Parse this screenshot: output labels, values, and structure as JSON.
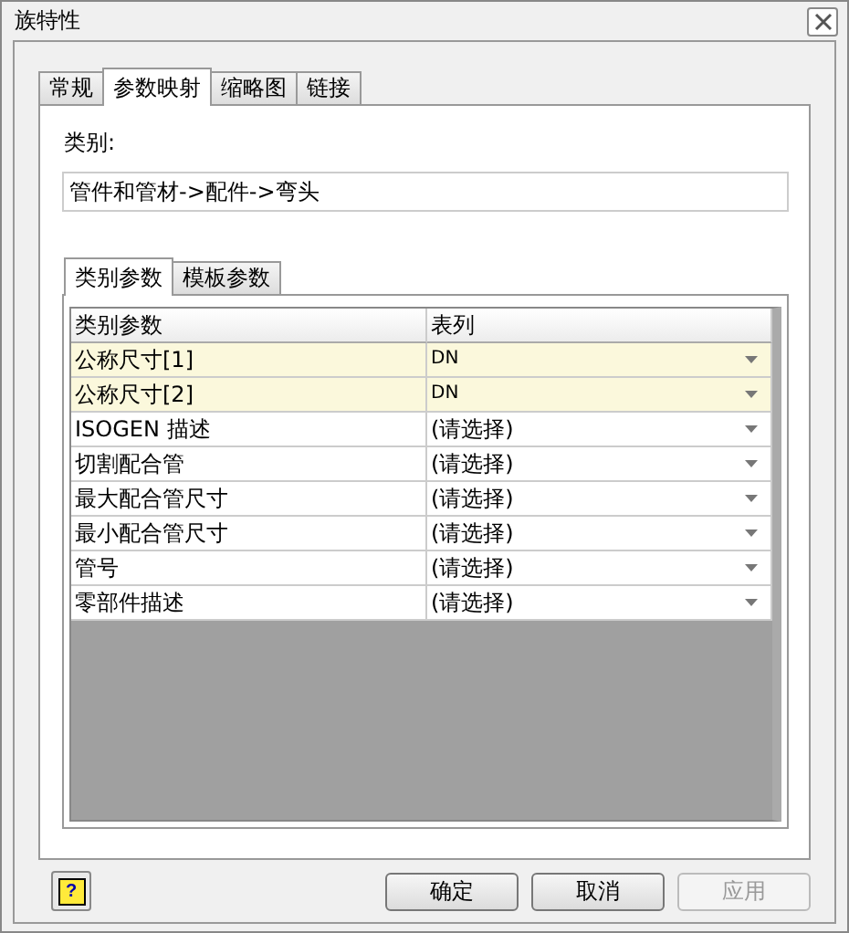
{
  "window": {
    "title": "族特性"
  },
  "tabs": [
    {
      "label": "常规",
      "selected": false
    },
    {
      "label": "参数映射",
      "selected": true
    },
    {
      "label": "缩略图",
      "selected": false
    },
    {
      "label": "链接",
      "selected": false
    }
  ],
  "category": {
    "label": "类别:",
    "value": "管件和管材->配件->弯头"
  },
  "sub_tabs": [
    {
      "label": "类别参数",
      "selected": true
    },
    {
      "label": "模板参数",
      "selected": false
    }
  ],
  "table": {
    "columns": [
      "类别参数",
      "表列"
    ],
    "rows": [
      {
        "param": "公称尺寸[1]",
        "column": "DN",
        "highlighted": true
      },
      {
        "param": "公称尺寸[2]",
        "column": "DN",
        "highlighted": true
      },
      {
        "param": "ISOGEN 描述",
        "column": "(请选择)",
        "highlighted": false
      },
      {
        "param": "切割配合管",
        "column": "(请选择)",
        "highlighted": false
      },
      {
        "param": "最大配合管尺寸",
        "column": "(请选择)",
        "highlighted": false
      },
      {
        "param": "最小配合管尺寸",
        "column": "(请选择)",
        "highlighted": false
      },
      {
        "param": "管号",
        "column": "(请选择)",
        "highlighted": false
      },
      {
        "param": "零部件描述",
        "column": "(请选择)",
        "highlighted": false
      }
    ]
  },
  "help_button": "?",
  "buttons": [
    {
      "label": "确定",
      "disabled": false
    },
    {
      "label": "取消",
      "disabled": false
    },
    {
      "label": "应用",
      "disabled": true
    }
  ]
}
